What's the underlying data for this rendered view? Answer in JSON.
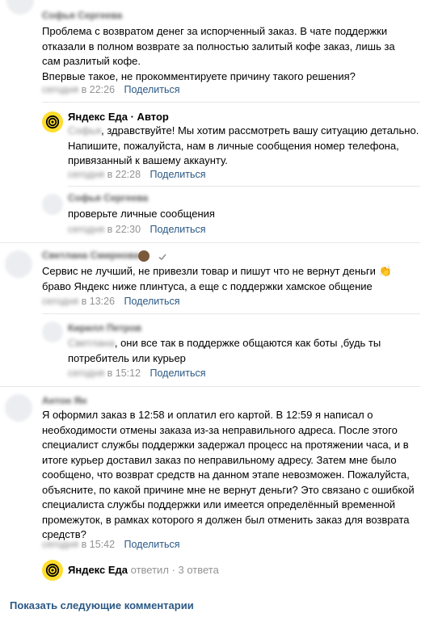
{
  "comments": [
    {
      "author": "Софья Сергеева",
      "text_lines": [
        "Проблема с возвратом денег за испорченный заказ. В чате поддержки",
        "отказали в полном возврате за полностью залитый кофе заказ, лишь за",
        "сам разлитый кофе.",
        "Впервые такое, не прокомментируете причину такого решения?"
      ],
      "date": "сегодня",
      "time": "в 22:26",
      "reply_label": "Поделиться",
      "replies": [
        {
          "author": "Яндекс Еда · Автор",
          "text_lines": [
            "Софья, здравствуйте! Мы хотим рассмотреть вашу ситуацию детально.",
            "Напишите, пожалуйста, нам в личные сообщения номер телефона,",
            "привязанный к вашему аккаунту."
          ],
          "greeting_blur": "Софья",
          "greeting_rest": ", здравствуйте! Мы хотим рассмотреть вашу ситуацию детально.",
          "date": "сегодня",
          "time": "в 22:28",
          "reply_label": "Поделиться"
        },
        {
          "author": "Софья Сергеева",
          "text_lines": [
            "проверьте личные сообщения"
          ],
          "date": "сегодня",
          "time": "в 22:30",
          "reply_label": "Поделиться"
        }
      ]
    },
    {
      "author": "Светлана Смирнова",
      "text_lines": [
        "Сервис не лучший, не привезли товар и пишут что не вернут деньги 👏",
        "браво Яндекс ниже плинтуса, а еще с поддержки хамское общение"
      ],
      "date": "сегодня",
      "time": "в 13:26",
      "reply_label": "Поделиться",
      "replies": [
        {
          "author": "Кирилл Петров",
          "text_lines": [
            "Светлана, они все так в поддержке общаются как боты ,будь ты",
            "потребитель или курьер"
          ],
          "greeting_blur": "Светлана",
          "greeting_rest": ", они все так в поддержке общаются как боты ,будь ты",
          "date": "сегодня",
          "time": "в 15:12",
          "reply_label": "Поделиться"
        }
      ]
    },
    {
      "author": "Антон Ян",
      "text_lines": [
        "Я оформил заказ в 12:58 и оплатил его картой. В 12:59 я написал о",
        "необходимости отмены заказа из-за неправильного адреса. После этого",
        "специалист службы поддержки задержал процесс на протяжении часа, и в",
        "итоге курьер доставил заказ по неправильному адресу. Затем мне было",
        "сообщено, что возврат средств на данном этапе невозможен. Пожалуйста,",
        "объясните, по какой причине мне не вернут деньги? Это связано с ошибкой",
        "специалиста службы поддержки или имеется определённый временной",
        "промежуток, в рамках которого я должен был отменить заказ для возврата",
        "средств?"
      ],
      "date": "сегодня",
      "time": "в 15:42",
      "reply_label": "Поделиться",
      "replied_by": "Яндекс Еда",
      "replied_word": "ответил",
      "replied_count": "3 ответа"
    }
  ],
  "show_more": "Показать следующие комментарии",
  "colors": {
    "link": "#2a5885",
    "meta": "#939393",
    "logo_yellow": "#ffdd2d",
    "separator": "#e7e8ec"
  }
}
